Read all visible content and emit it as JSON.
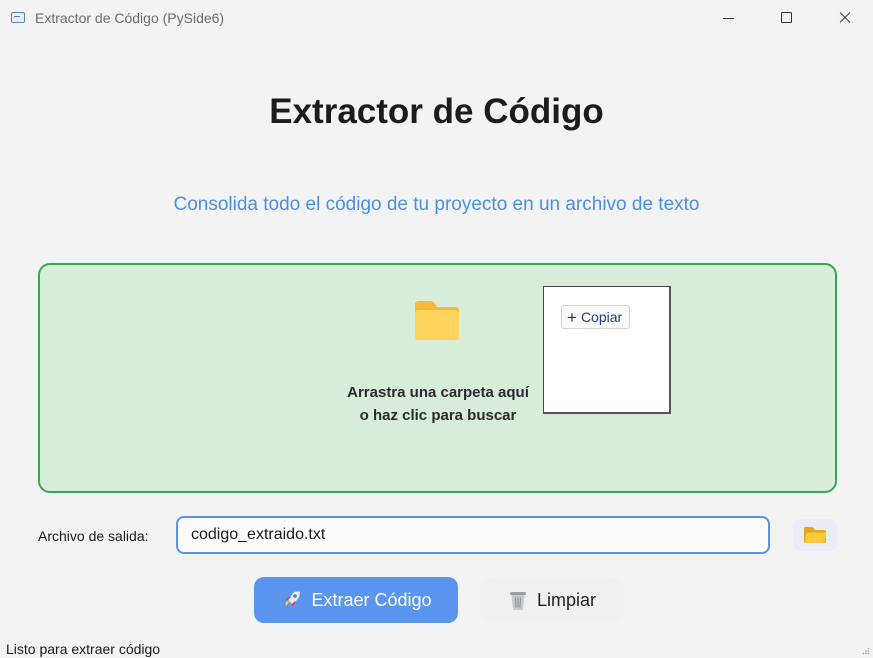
{
  "window": {
    "title": "Extractor de Código (PySide6)",
    "icon": "app-window-icon",
    "controls": [
      "minimize-icon",
      "maximize-icon",
      "close-icon"
    ]
  },
  "header": {
    "title": "Extractor de Código",
    "subtitle": "Consolida todo el código de tu proyecto en un archivo de texto"
  },
  "dropzone": {
    "icon": "folder-icon",
    "line1": "Arrastra una carpeta aquí",
    "line2": "o haz clic para buscar",
    "border_color": "#34a853",
    "background": "#d8ecda"
  },
  "context_popup": {
    "copy_label": "Copiar",
    "copy_icon": "plus-icon"
  },
  "output": {
    "label": "Archivo de salida:",
    "value": "codigo_extraido.txt",
    "browse_icon": "folder-icon"
  },
  "actions": {
    "extract_label": "Extraer Código",
    "extract_icon": "rocket-icon",
    "clear_label": "Limpiar",
    "clear_icon": "trash-icon",
    "accent": "#5a96f0"
  },
  "status": {
    "text": "Listo para extraer código"
  }
}
